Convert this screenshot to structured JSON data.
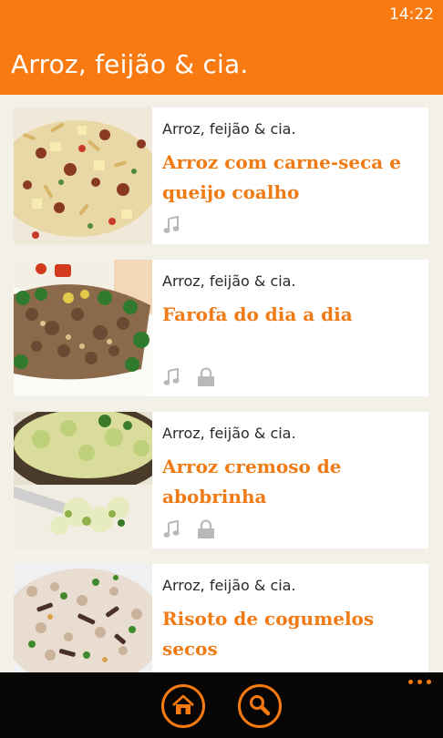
{
  "status_bar": {
    "time": "14:22"
  },
  "header": {
    "title": "Arroz, feijão & cia."
  },
  "recipes": [
    {
      "category": "Arroz, feijão & cia.",
      "title": "Arroz com carne-seca e queijo coalho",
      "icons": [
        "music-note-icon"
      ]
    },
    {
      "category": "Arroz, feijão & cia.",
      "title": "Farofa do dia a dia",
      "icons": [
        "music-note-icon",
        "lock-icon"
      ]
    },
    {
      "category": "Arroz, feijão & cia.",
      "title": "Arroz cremoso de abobrinha",
      "icons": [
        "music-note-icon",
        "lock-icon"
      ]
    },
    {
      "category": "Arroz, feijão & cia.",
      "title": "Risoto de cogumelos secos",
      "icons": []
    }
  ],
  "app_bar": {
    "buttons": [
      "home-icon",
      "search-icon"
    ],
    "more": "more-icon"
  },
  "colors": {
    "accent": "#f97a10",
    "title_text": "#f07a14",
    "background": "#f3f0e8",
    "app_bar": "#070605"
  }
}
